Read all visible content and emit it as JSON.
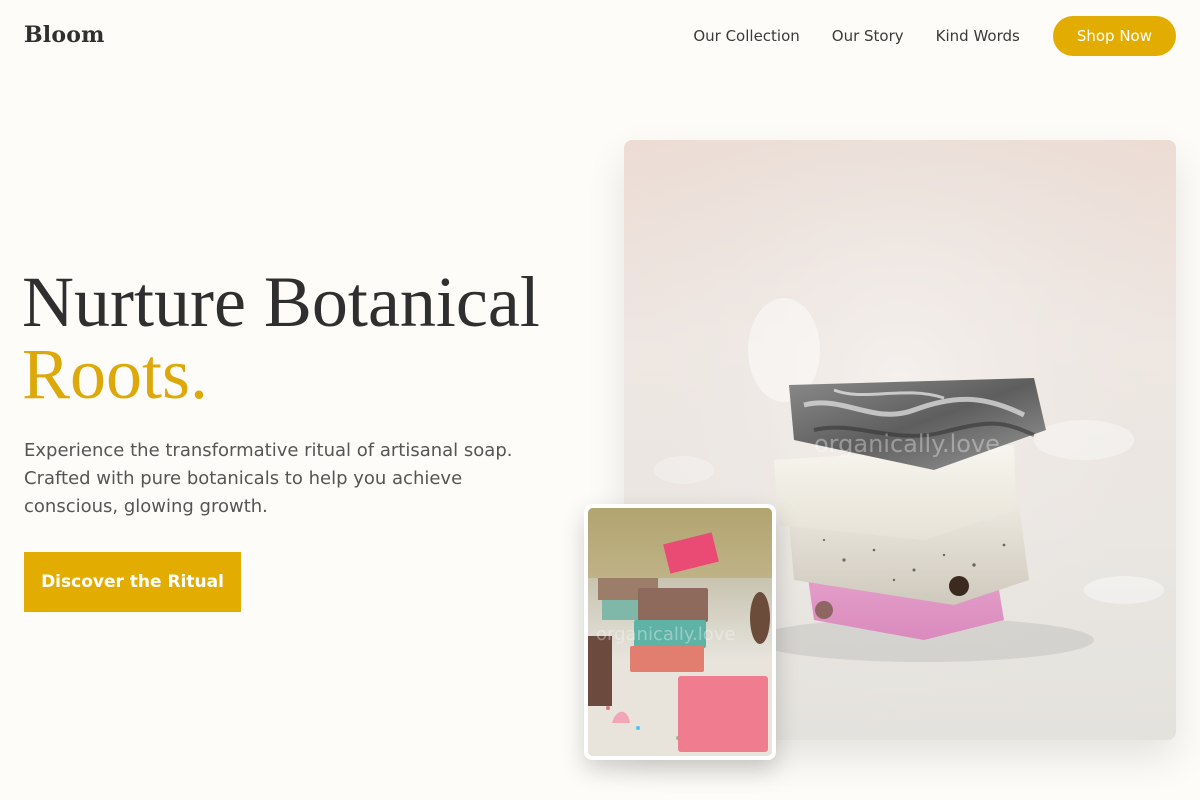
{
  "brand": {
    "name": "Bloom"
  },
  "nav": {
    "links": [
      "Our Collection",
      "Our Story",
      "Kind Words"
    ],
    "cta_label": "Shop Now"
  },
  "hero": {
    "title_line1": "Nurture Botanical",
    "title_line2": "Roots.",
    "description": "Experience the transformative ritual of artisanal soap. Crafted with pure botanicals to help you achieve conscious, glowing growth.",
    "cta_label": "Discover the Ritual"
  },
  "colors": {
    "accent": "#e2ad00",
    "title_accent": "#dda809",
    "background": "#fdfcf8",
    "text_dark": "#2f2f2f",
    "text_body": "#555555"
  },
  "images": {
    "main": {
      "watermark": "organically.love"
    },
    "secondary": {
      "watermark": "organically.love"
    }
  }
}
